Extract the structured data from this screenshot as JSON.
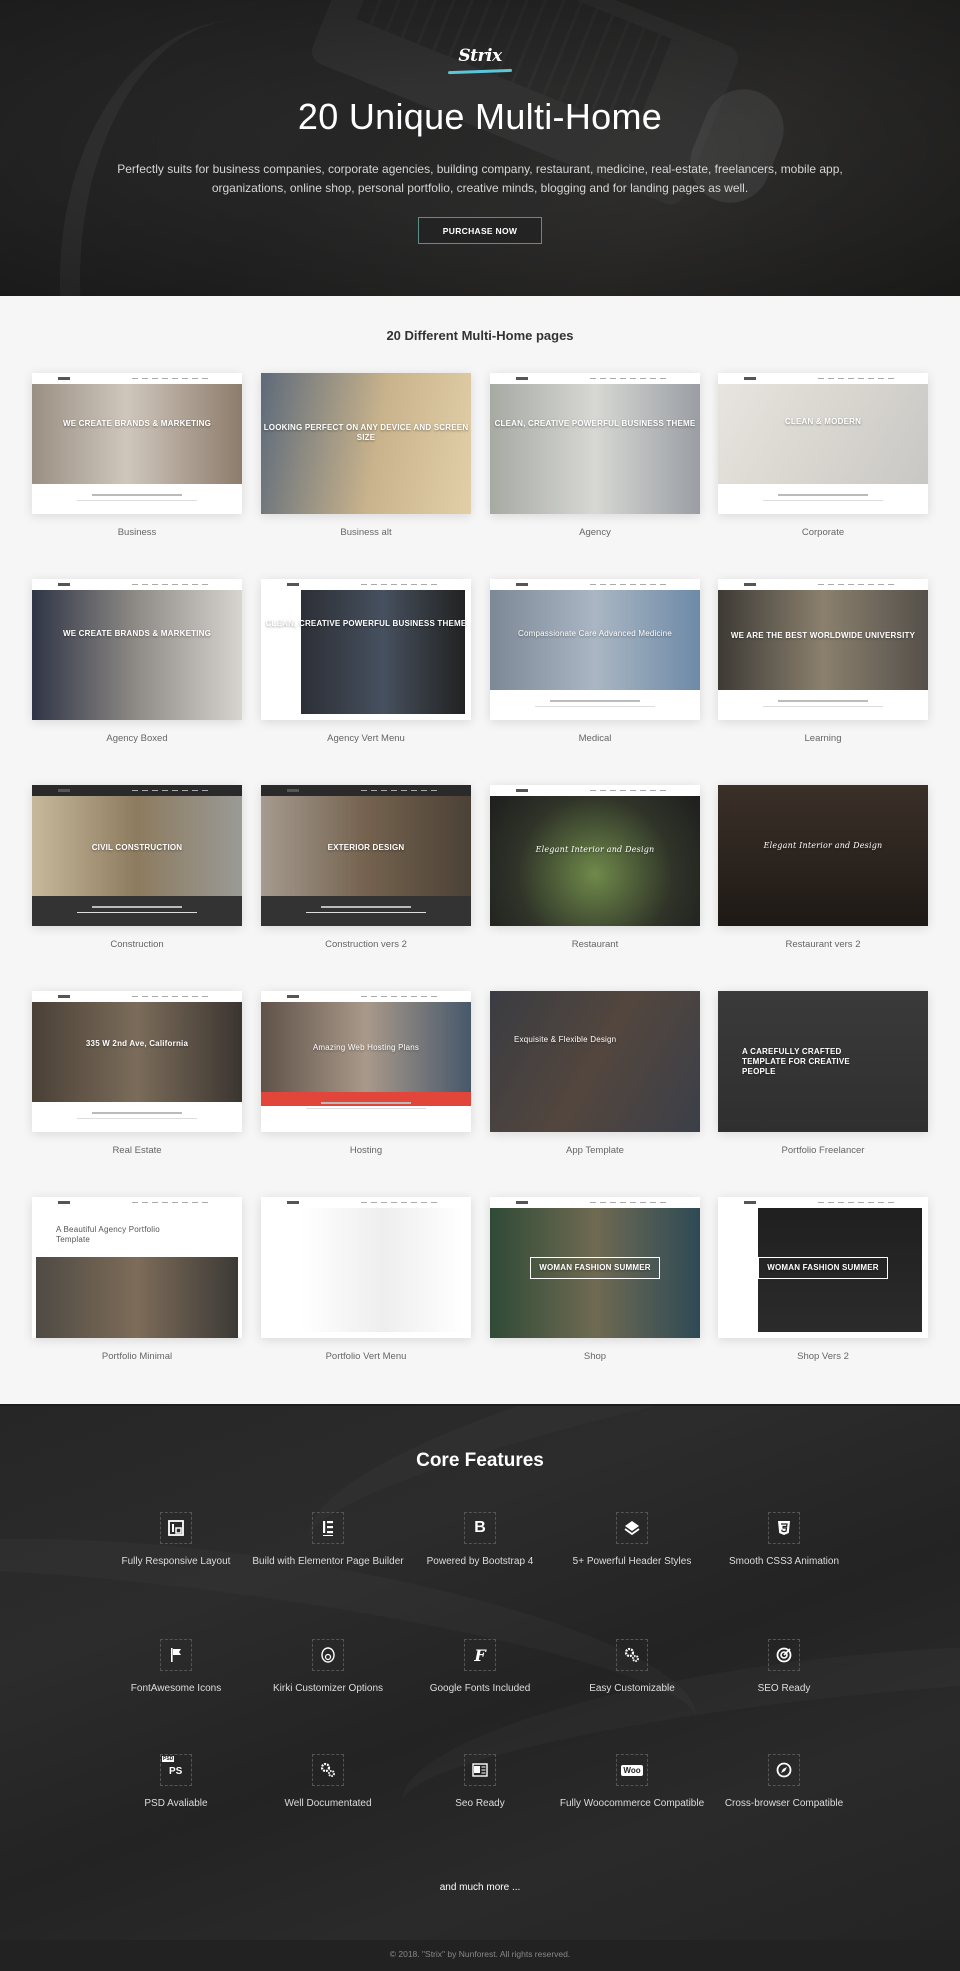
{
  "hero": {
    "logo": "Strix",
    "title": "20 Unique Multi-Home",
    "description": "Perfectly suits for business companies, corporate agencies, building company, restaurant, medicine, real-estate, freelancers, mobile app, organizations, online shop, personal portfolio, creative minds, blogging and for landing pages as well.",
    "purchase_label": "PURCHASE NOW",
    "accent_color": "#5bc6d8"
  },
  "pages": {
    "title": "20 Different Multi-Home pages",
    "items": [
      {
        "label": "Business",
        "headline": "WE CREATE BRANDS & MARKETING"
      },
      {
        "label": "Business alt",
        "headline": "LOOKING PERFECT ON ANY DEVICE AND SCREEN SIZE"
      },
      {
        "label": "Agency",
        "headline": "CLEAN, CREATIVE POWERFUL BUSINESS THEME"
      },
      {
        "label": "Corporate",
        "headline": "CLEAN & MODERN"
      },
      {
        "label": "Agency Boxed",
        "headline": "WE CREATE BRANDS & MARKETING"
      },
      {
        "label": "Agency Vert Menu",
        "headline": "CLEAN, CREATIVE POWERFUL BUSINESS THEME"
      },
      {
        "label": "Medical",
        "headline": "Compassionate Care Advanced Medicine"
      },
      {
        "label": "Learning",
        "headline": "WE ARE THE BEST WORLDWIDE UNIVERSITY"
      },
      {
        "label": "Construction",
        "headline": "CIVIL CONSTRUCTION"
      },
      {
        "label": "Construction vers 2",
        "headline": "EXTERIOR DESIGN"
      },
      {
        "label": "Restaurant",
        "headline": "Elegant Interior and Design"
      },
      {
        "label": "Restaurant vers 2",
        "headline": "Elegant Interior and Design"
      },
      {
        "label": "Real Estate",
        "headline": "335 W 2nd Ave, California"
      },
      {
        "label": "Hosting",
        "headline": "Amazing Web Hosting Plans"
      },
      {
        "label": "App Template",
        "headline": "Exquisite & Flexible Design"
      },
      {
        "label": "Portfolio Freelancer",
        "headline": "A CAREFULLY CRAFTED TEMPLATE FOR CREATIVE PEOPLE"
      },
      {
        "label": "Portfolio Minimal",
        "headline": "A Beautiful Agency Portfolio Template"
      },
      {
        "label": "Portfolio Vert Menu",
        "headline": ""
      },
      {
        "label": "Shop",
        "headline": "WOMAN FASHION SUMMER"
      },
      {
        "label": "Shop Vers 2",
        "headline": "WOMAN FASHION SUMMER"
      }
    ]
  },
  "features": {
    "title": "Core Features",
    "items": [
      {
        "label": "Fully Responsive Layout",
        "icon": "responsive-layout-icon"
      },
      {
        "label": "Build with Elementor Page Builder",
        "icon": "elementor-icon"
      },
      {
        "label": "Powered by Bootstrap 4",
        "icon": "bootstrap-icon"
      },
      {
        "label": "5+ Powerful Header Styles",
        "icon": "layers-icon"
      },
      {
        "label": "Smooth CSS3 Animation",
        "icon": "css3-icon"
      },
      {
        "label": "FontAwesome Icons",
        "icon": "flag-icon"
      },
      {
        "label": "Kirki Customizer Options",
        "icon": "kirki-icon"
      },
      {
        "label": "Google Fonts Included",
        "icon": "font-icon"
      },
      {
        "label": "Easy Customizable",
        "icon": "gears-icon"
      },
      {
        "label": "SEO Ready",
        "icon": "target-icon"
      },
      {
        "label": "PSD Avaliable",
        "icon": "psd-icon"
      },
      {
        "label": "Well Documentated",
        "icon": "gears-icon"
      },
      {
        "label": "Seo Ready",
        "icon": "word-document-icon"
      },
      {
        "label": "Fully Woocommerce Compatible",
        "icon": "woocommerce-icon"
      },
      {
        "label": "Cross-browser Compatible",
        "icon": "compass-icon"
      }
    ],
    "much_more": "and much more ..."
  },
  "footer": {
    "copyright": "© 2018. \"Strix\" by Nunforest. All rights reserved."
  }
}
